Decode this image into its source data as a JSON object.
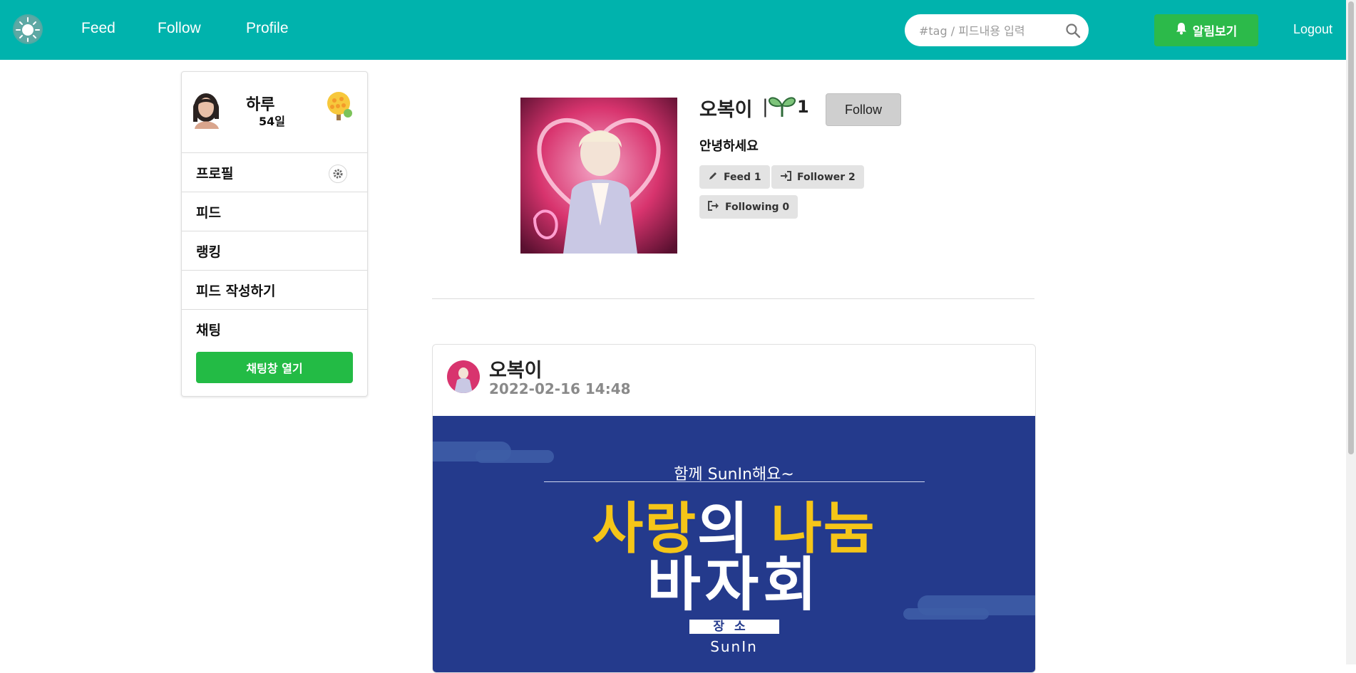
{
  "nav": {
    "links": [
      "Feed",
      "Follow",
      "Profile"
    ],
    "search_placeholder": "#tag / 피드내용 입력",
    "alarm_label": "알림보기",
    "logout_label": "Logout",
    "colors": {
      "navbar": "#00b3ad",
      "alarm": "#2cba4a"
    }
  },
  "sidebar": {
    "user_name": "하루",
    "user_days": "54일",
    "items": [
      "프로필",
      "피드",
      "랭킹",
      "피드 작성하기",
      "채팅"
    ],
    "chat_button": "채팅창 열기"
  },
  "profile": {
    "name": "오복이",
    "separator": "|",
    "level": "1",
    "follow_button": "Follow",
    "intro": "안녕하세요",
    "stats": {
      "feed": "Feed 1",
      "follower": "Follower 2",
      "following": "Following 0"
    }
  },
  "post": {
    "author": "오복이",
    "date": "2022-02-16 14:48",
    "poster": {
      "subtitle": "함께 SunIn해요~",
      "title_part1": "사랑",
      "title_part2": "의 ",
      "title_part3": "나눔",
      "title_line2": "바자회",
      "place_label": "장소",
      "place": "SunIn",
      "colors": {
        "background": "#243a8c",
        "highlight": "#f5c518"
      }
    }
  }
}
